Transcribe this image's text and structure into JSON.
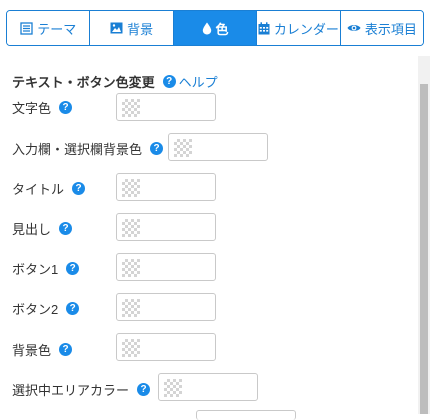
{
  "tabs": [
    {
      "label": "テーマ",
      "icon": "list-icon"
    },
    {
      "label": "背景",
      "icon": "image-icon"
    },
    {
      "label": "色",
      "icon": "droplet-icon",
      "active": true
    },
    {
      "label": "カレンダー",
      "icon": "calendar-icon"
    },
    {
      "label": "表示項目",
      "icon": "eye-icon"
    }
  ],
  "section": {
    "title": "テキスト・ボタン色変更",
    "help_label": "ヘルプ"
  },
  "color_fields": [
    {
      "label": "文字色"
    },
    {
      "label": "入力欄・選択欄背景色"
    },
    {
      "label": "タイトル"
    },
    {
      "label": "見出し"
    },
    {
      "label": "ボタン1"
    },
    {
      "label": "ボタン2"
    },
    {
      "label": "背景色"
    },
    {
      "label": "選択中エリアカラー"
    }
  ],
  "colors": {
    "accent": "#1a8be8",
    "border": "#1a7fd4"
  }
}
